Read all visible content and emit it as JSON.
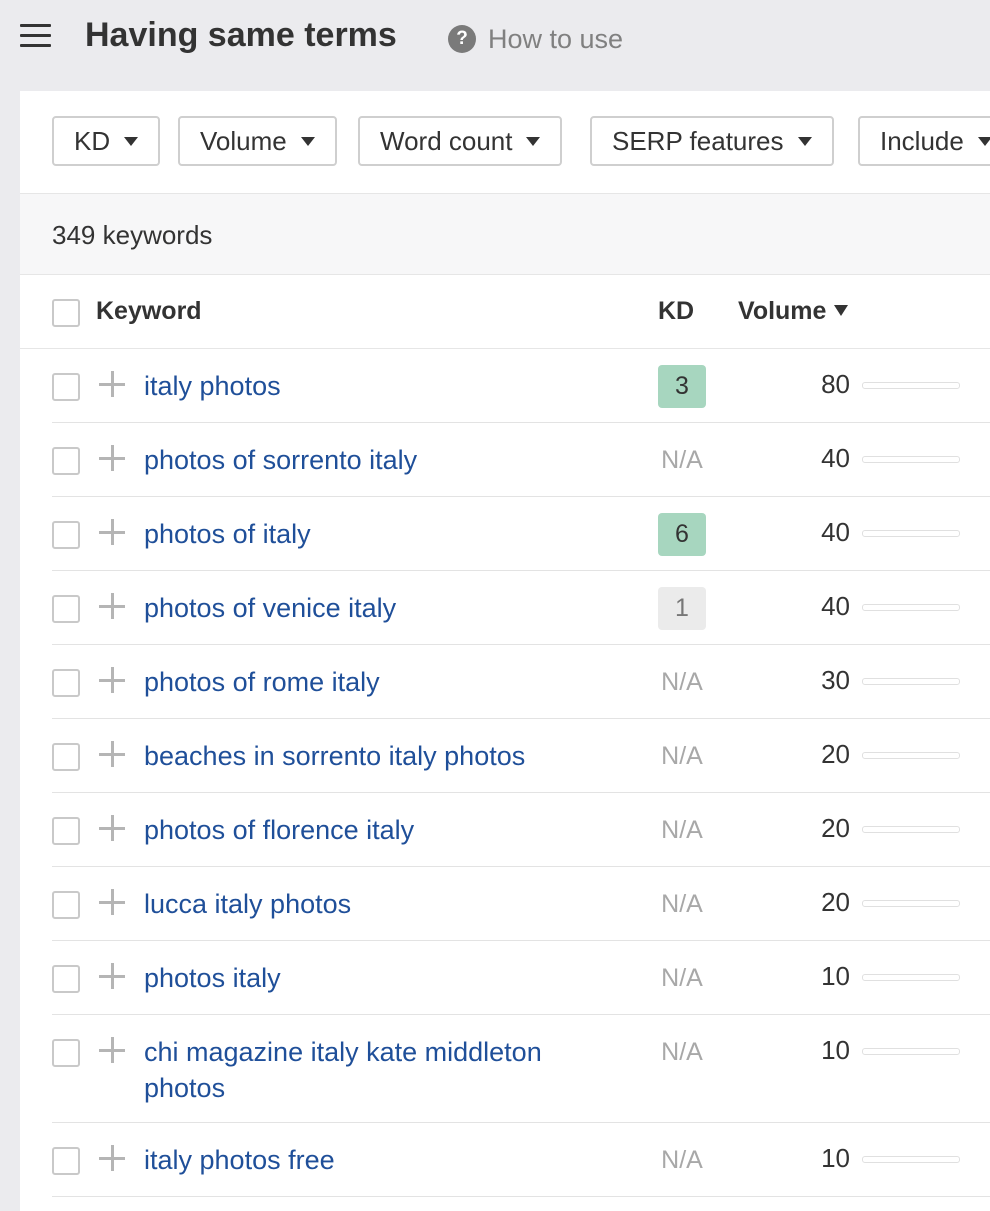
{
  "header": {
    "menu_icon": "hamburger-menu-icon",
    "title": "Having same terms",
    "help_icon": "question-circle-icon",
    "help_label": "How to use"
  },
  "filters": [
    {
      "label": "KD",
      "icon": "caret-down-icon"
    },
    {
      "label": "Volume",
      "icon": "caret-down-icon"
    },
    {
      "label": "Word count",
      "icon": "caret-down-icon"
    },
    {
      "label": "SERP features",
      "icon": "caret-down-icon"
    },
    {
      "label": "Include",
      "icon": "caret-down-icon"
    }
  ],
  "summary": {
    "count_text": "349 keywords"
  },
  "table": {
    "columns": {
      "keyword": "Keyword",
      "kd": "KD",
      "volume": "Volume",
      "sort_icon": "sort-desc-icon"
    },
    "rows": [
      {
        "keyword": "italy photos",
        "kd": "3",
        "kd_style": "green",
        "volume": "80"
      },
      {
        "keyword": "photos of sorrento italy",
        "kd": "N/A",
        "kd_style": "na",
        "volume": "40"
      },
      {
        "keyword": "photos of italy",
        "kd": "6",
        "kd_style": "green",
        "volume": "40"
      },
      {
        "keyword": "photos of venice italy",
        "kd": "1",
        "kd_style": "grey",
        "volume": "40"
      },
      {
        "keyword": "photos of rome italy",
        "kd": "N/A",
        "kd_style": "na",
        "volume": "30"
      },
      {
        "keyword": "beaches in sorrento italy photos",
        "kd": "N/A",
        "kd_style": "na",
        "volume": "20"
      },
      {
        "keyword": "photos of florence italy",
        "kd": "N/A",
        "kd_style": "na",
        "volume": "20"
      },
      {
        "keyword": "lucca italy photos",
        "kd": "N/A",
        "kd_style": "na",
        "volume": "20"
      },
      {
        "keyword": "photos italy",
        "kd": "N/A",
        "kd_style": "na",
        "volume": "10"
      },
      {
        "keyword": "chi magazine italy kate middleton photos",
        "kd": "N/A",
        "kd_style": "na",
        "volume": "10"
      },
      {
        "keyword": "italy photos free",
        "kd": "N/A",
        "kd_style": "na",
        "volume": "10"
      }
    ]
  },
  "colors": {
    "link": "#1f4f99",
    "kd_green": "#a7d6bf",
    "kd_grey": "#ebebeb",
    "page_bg": "#ebebee"
  }
}
